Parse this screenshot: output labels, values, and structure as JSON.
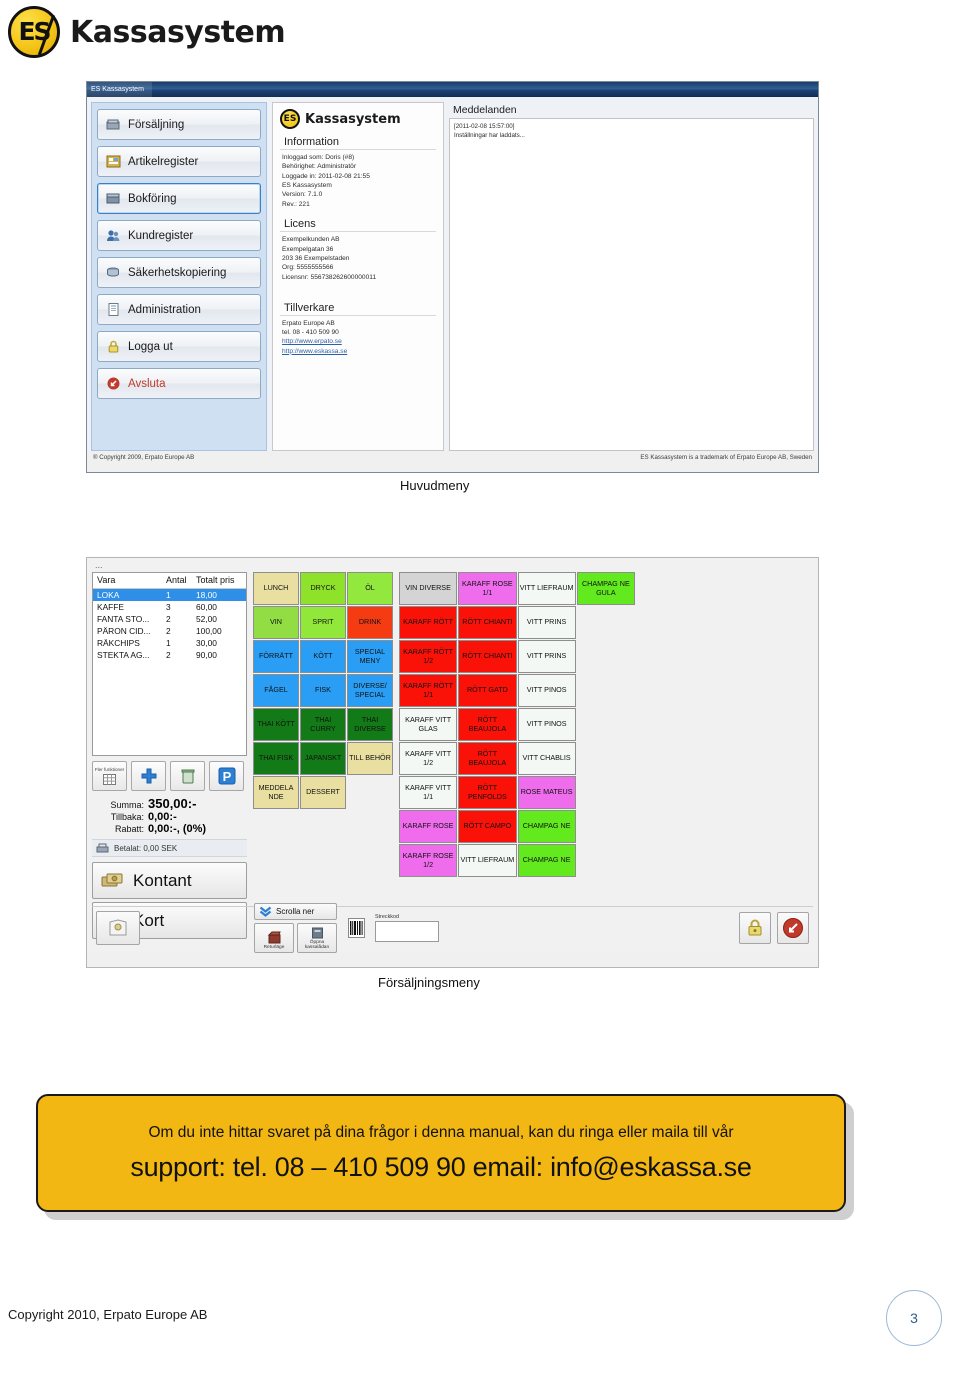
{
  "brand": {
    "name": "Kassasystem",
    "logo_mark": "es-logo-icon"
  },
  "main_window": {
    "titlebar": "ES Kassasystem",
    "nav": {
      "items": [
        {
          "label": "Försäljning",
          "icon": "sales-icon",
          "active": false
        },
        {
          "label": "Artikelregister",
          "icon": "articles-icon",
          "active": false
        },
        {
          "label": "Bokföring",
          "icon": "ledger-icon",
          "active": true
        },
        {
          "label": "Kundregister",
          "icon": "customers-icon",
          "active": false
        },
        {
          "label": "Säkerhetskopiering",
          "icon": "backup-icon",
          "active": false
        },
        {
          "label": "Administration",
          "icon": "admin-icon",
          "active": false
        },
        {
          "label": "Logga ut",
          "icon": "lock-icon",
          "active": false
        },
        {
          "label": "Avsluta",
          "icon": "exit-icon",
          "active": false
        }
      ]
    },
    "info_panel": {
      "brand_title": "Kassasystem",
      "information": {
        "heading": "Information",
        "lines": [
          "Inloggad som: Doris (#8)",
          "Behörighet: Administratör",
          "Loggade in: 2011-02-08 21:55",
          "ES Kassasystem",
          "Version: 7.1.0",
          "Rev.: 221"
        ]
      },
      "licens": {
        "heading": "Licens",
        "lines": [
          "Exempelkunden AB",
          "Exempelgatan 36",
          "203 36   Exempelstaden",
          "Org: 5555555566",
          "Licensnr: 556738262600000011"
        ]
      },
      "tillverkare": {
        "heading": "Tillverkare",
        "lines": [
          "Erpato Europe AB",
          "tel. 08 - 410 509 90"
        ],
        "links": [
          "http://www.erpato.se",
          "http://www.eskassa.se"
        ]
      }
    },
    "messages": {
      "heading": "Meddelanden",
      "lines": [
        "[2011-02-08 15:57:00]",
        "Inställningar har laddats..."
      ]
    },
    "footer": {
      "copyright": "® Copyright 2009, Erpato Europe AB",
      "trademark": "ES Kassasystem is a trademark of Erpato Europe AB, Sweden"
    }
  },
  "pos_window": {
    "dots": "...",
    "receipt": {
      "headers": [
        "Vara",
        "Antal",
        "Totalt pris"
      ],
      "rows": [
        {
          "vara": "LOKA",
          "antal": "1",
          "pris": "18,00",
          "selected": true
        },
        {
          "vara": "KAFFE",
          "antal": "3",
          "pris": "60,00",
          "selected": false
        },
        {
          "vara": "FANTA STO...",
          "antal": "2",
          "pris": "52,00",
          "selected": false
        },
        {
          "vara": "PÄRON CID...",
          "antal": "2",
          "pris": "100,00",
          "selected": false
        },
        {
          "vara": "RÄKCHIPS",
          "antal": "1",
          "pris": "30,00",
          "selected": false
        },
        {
          "vara": "STEKTA AG...",
          "antal": "2",
          "pris": "90,00",
          "selected": false
        }
      ]
    },
    "fn_buttons": [
      {
        "label": "Fler funktioner",
        "icon": "grid-icon"
      },
      {
        "label": "",
        "icon": "plus-icon"
      },
      {
        "label": "",
        "icon": "trash-icon"
      },
      {
        "label": "",
        "icon": "park-icon"
      }
    ],
    "totals": [
      {
        "label": "Summa:",
        "value": "350,00:-"
      },
      {
        "label": "Tillbaka:",
        "value": "0,00:-"
      },
      {
        "label": "Rabatt:",
        "value": "0,00:-, (0%)"
      }
    ],
    "paid": {
      "label": "Betalat: 0,00 SEK",
      "icon": "printer-icon"
    },
    "pay_buttons": [
      {
        "label": "Kontant",
        "icon": "cash-icon"
      },
      {
        "label": "Kort",
        "icon": "card-icon"
      }
    ],
    "categories": [
      {
        "label": "LUNCH",
        "color": "#e8dfa0"
      },
      {
        "label": "DRYCK",
        "color": "#8ee32a"
      },
      {
        "label": "ÖL",
        "color": "#93e83d"
      },
      {
        "label": "VIN",
        "color": "#92dd44"
      },
      {
        "label": "SPRIT",
        "color": "#91e83a"
      },
      {
        "label": "DRINK",
        "color": "#f53b12"
      },
      {
        "label": "FÖRRÄTT",
        "color": "#2a9ef4"
      },
      {
        "label": "KÖTT",
        "color": "#2a9ef4"
      },
      {
        "label": "SPECIAL MENY",
        "color": "#2a9ef4"
      },
      {
        "label": "FÅGEL",
        "color": "#2a9ef4"
      },
      {
        "label": "FISK",
        "color": "#2a9ef4"
      },
      {
        "label": "DIVERSE/ SPECIAL",
        "color": "#2a9ef4"
      },
      {
        "label": "THAI KÖTT",
        "color": "#137a18"
      },
      {
        "label": "THAI CURRY",
        "color": "#137a18"
      },
      {
        "label": "THAI DIVERSE",
        "color": "#137a18"
      },
      {
        "label": "THAI FISK",
        "color": "#137a18"
      },
      {
        "label": "JAPANSKT",
        "color": "#137a18"
      },
      {
        "label": "TILL BEHÖR",
        "color": "#e8dfa0"
      },
      {
        "label": "MEDDELA NDE",
        "color": "#e8dfa0"
      },
      {
        "label": "DESSERT",
        "color": "#e8dfa0"
      },
      {
        "label": "",
        "color": ""
      }
    ],
    "products": [
      {
        "label": "VIN DIVERSE",
        "color": "#d4d4d4"
      },
      {
        "label": "KARAFF ROSE 1/1",
        "color": "#ef6ded"
      },
      {
        "label": "VITT LIEFRAUM",
        "color": "#f4f8f4"
      },
      {
        "label": "CHAMPAG NE GULA",
        "color": "#62ea1e"
      },
      {
        "label": "KARAFF RÖTT",
        "color": "#fa1209"
      },
      {
        "label": "RÖTT CHIANTI",
        "color": "#fa1209"
      },
      {
        "label": "VITT PRINS",
        "color": "#f4f8f4"
      },
      {
        "label": "",
        "color": ""
      },
      {
        "label": "KARAFF RÖTT 1/2",
        "color": "#fa1209"
      },
      {
        "label": "RÖTT CHIANTI",
        "color": "#fa1209"
      },
      {
        "label": "VITT PRINS",
        "color": "#f4f8f4"
      },
      {
        "label": "",
        "color": ""
      },
      {
        "label": "KARAFF RÖTT 1/1",
        "color": "#fa1209"
      },
      {
        "label": "RÖTT GATD",
        "color": "#fa1209"
      },
      {
        "label": "VITT PINOS",
        "color": "#f4f8f4"
      },
      {
        "label": "",
        "color": ""
      },
      {
        "label": "KARAFF VITT GLAS",
        "color": "#f4f8f4"
      },
      {
        "label": "RÖTT BEAUJOLA",
        "color": "#fa1209"
      },
      {
        "label": "VITT PINOS",
        "color": "#f4f8f4"
      },
      {
        "label": "",
        "color": ""
      },
      {
        "label": "KARAFF VITT 1/2",
        "color": "#f4f8f4"
      },
      {
        "label": "RÖTT BEAUJOLA",
        "color": "#fa1209"
      },
      {
        "label": "VITT CHABLIS",
        "color": "#f4f8f4"
      },
      {
        "label": "",
        "color": ""
      },
      {
        "label": "KARAFF VITT 1/1",
        "color": "#f4f8f4"
      },
      {
        "label": "RÖTT PENFOLDS",
        "color": "#fa1209"
      },
      {
        "label": "ROSE MATEUS",
        "color": "#ef6ded"
      },
      {
        "label": "",
        "color": ""
      },
      {
        "label": "KARAFF ROSE",
        "color": "#ef6ded"
      },
      {
        "label": "RÖTT CAMPO",
        "color": "#fa1209"
      },
      {
        "label": "CHAMPAG NE",
        "color": "#62ea1e"
      },
      {
        "label": "",
        "color": ""
      },
      {
        "label": "KARAFF ROSE 1/2",
        "color": "#ef6ded"
      },
      {
        "label": "VITT LIEFRAUM",
        "color": "#f4f8f4"
      },
      {
        "label": "CHAMPAG NE",
        "color": "#62ea1e"
      },
      {
        "label": "",
        "color": ""
      }
    ],
    "bottom": {
      "scroll_label": "Scrolla ner",
      "return_label": "Returläge",
      "drawer_label": "Öppna kassalådan",
      "barcode_label": "Streckkod",
      "barcode_value": "",
      "barcode_placeholder": "",
      "lock_icon": "lock-icon",
      "exit_icon": "exit-icon"
    }
  },
  "captions": {
    "main": "Huvudmeny",
    "pos": "Försäljningsmeny"
  },
  "callout": {
    "line1": "Om du inte hittar svaret på dina frågor i denna manual, kan du ringa eller maila till vår",
    "line2": "support: tel. 08 – 410 509 90  email: info@eskassa.se",
    "bg_color": "#f2b713"
  },
  "footer": {
    "copyright": "Copyright 2010, Erpato Europe AB",
    "page_number": "3"
  }
}
